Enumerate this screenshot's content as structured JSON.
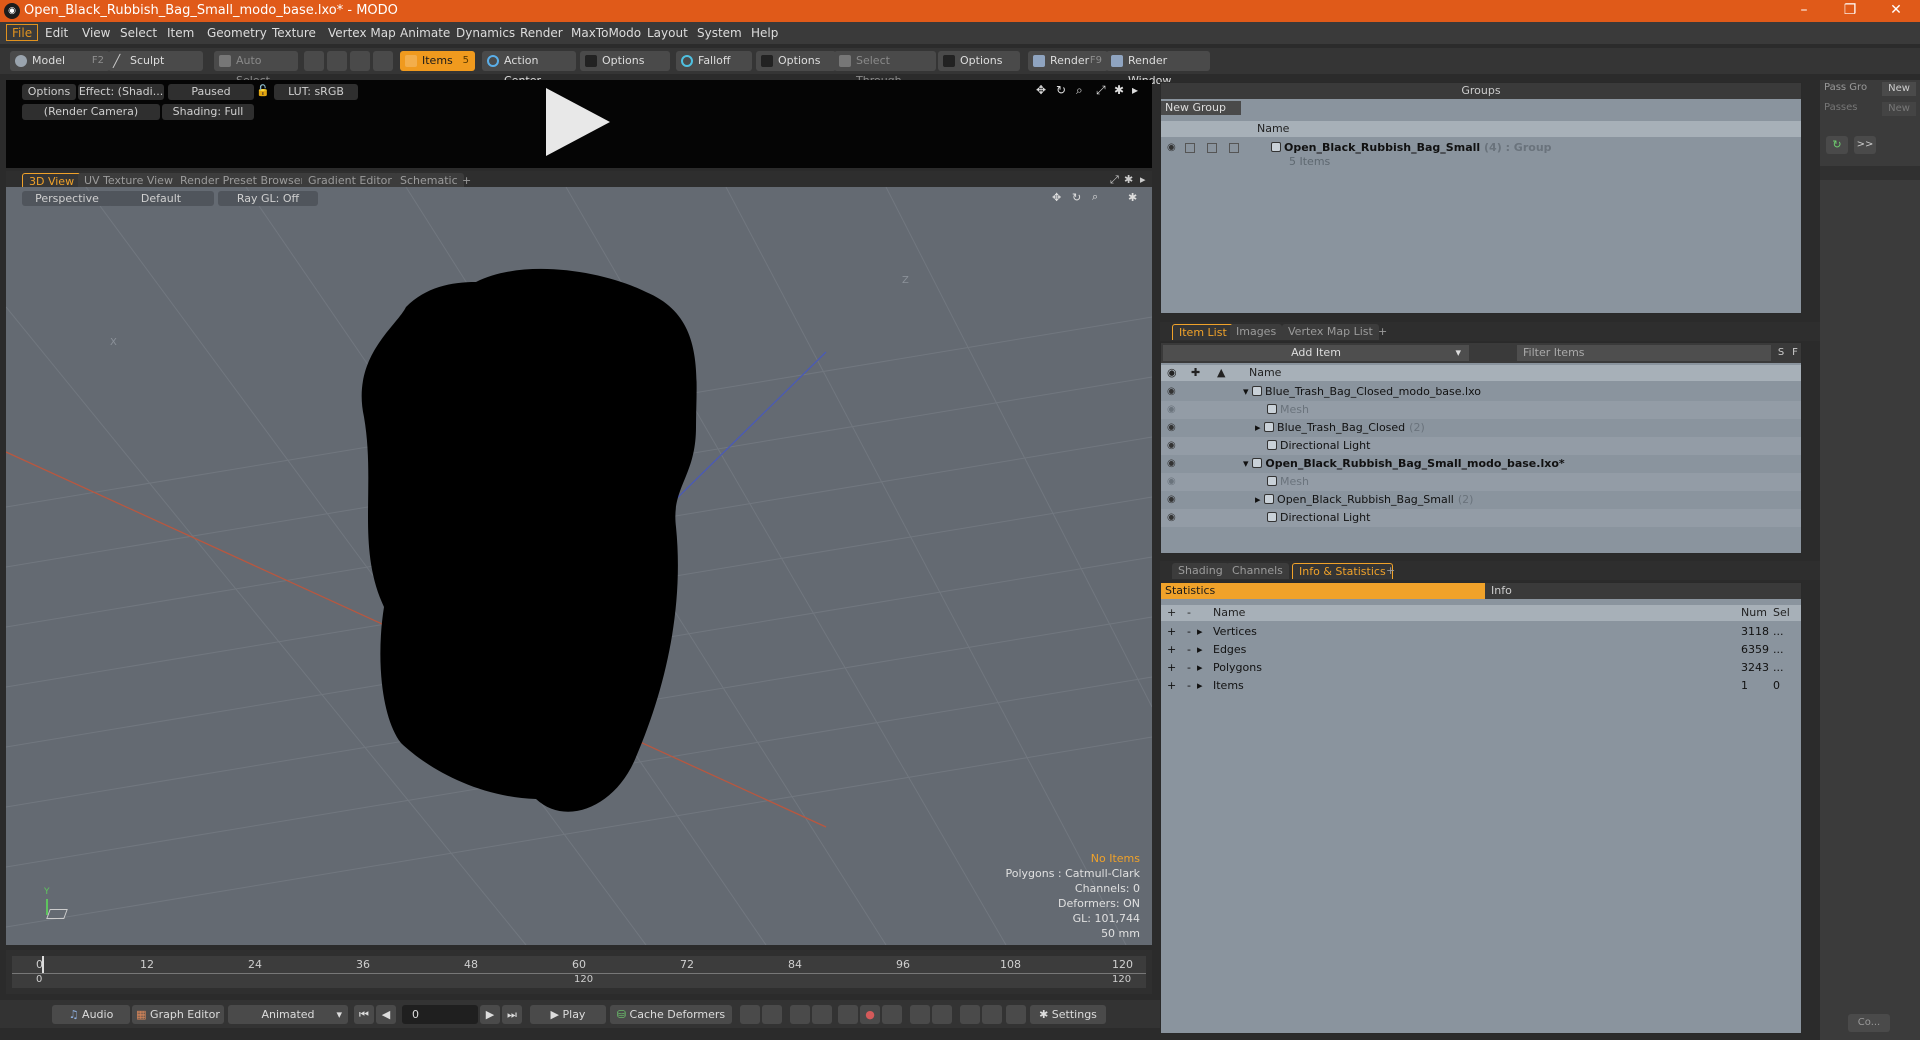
{
  "window": {
    "title": "Open_Black_Rubbish_Bag_Small_modo_base.lxo* - MODO",
    "logo": "modo-logo-icon",
    "minimize": "–",
    "restore": "❐",
    "close": "✕"
  },
  "menu": [
    "File",
    "Edit",
    "View",
    "Select",
    "Item",
    "Geometry",
    "Texture",
    "Vertex Map",
    "Animate",
    "Dynamics",
    "Render",
    "MaxToModo",
    "Layout",
    "System",
    "Help"
  ],
  "toolbar": {
    "model": "Model",
    "model_key": "F2",
    "sculpt": "Sculpt",
    "auto_select": "Auto Select",
    "items": "Items",
    "items_key": "5",
    "action_center": "Action Center",
    "options1": "Options",
    "falloff": "Falloff",
    "options2": "Options",
    "select_through": "Select Through",
    "options3": "Options",
    "render": "Render",
    "render_key": "F9",
    "render_window": "Render Window"
  },
  "preview": {
    "options": "Options",
    "effect": "Effect: (Shadi...",
    "paused": "Paused",
    "lut": "LUT: sRGB",
    "camera": "(Render Camera)",
    "shading": "Shading: Full"
  },
  "view_tabs": [
    "3D View",
    "UV Texture View",
    "Render Preset Browser",
    "Gradient Editor",
    "Schematic",
    "+"
  ],
  "viewport": {
    "perspective": "Perspective",
    "default": "Default",
    "raygl": "Ray GL: Off",
    "axis_x": "X",
    "axis_z": "Z",
    "axis_y": "Y"
  },
  "overlay": {
    "no_items": "No Items",
    "polygons": "Polygons : Catmull-Clark",
    "channels": "Channels: 0",
    "deformers": "Deformers: ON",
    "gl": "GL: 101,744",
    "focal": "50 mm"
  },
  "timeline": {
    "ticks": [
      "0",
      "12",
      "24",
      "36",
      "48",
      "60",
      "72",
      "84",
      "96",
      "108",
      "120"
    ],
    "start": "0",
    "mid": "120",
    "end": "120"
  },
  "bottombar": {
    "audio": "Audio",
    "graph_editor": "Graph Editor",
    "animated": "Animated",
    "frame": "0",
    "play": "Play",
    "cache": "Cache Deformers",
    "settings": "Settings"
  },
  "groups": {
    "title": "Groups",
    "new_group": "New Group",
    "col_name": "Name",
    "item_name": "Open_Black_Rubbish_Bag_Small",
    "item_count": "(4)",
    "item_type": ": Group",
    "item_sub": "5 Items"
  },
  "pass": {
    "pass_gro": "Pass Gro",
    "new1": "New",
    "passes": "Passes",
    "new2": "New",
    "arrow": ">>",
    "co": "Co..."
  },
  "itemlist_tabs": [
    "Item List",
    "Images",
    "Vertex Map List",
    "+"
  ],
  "itemlist": {
    "add_item": "Add Item",
    "filter": "Filter Items",
    "s": "S",
    "f": "F",
    "col_name": "Name",
    "rows": [
      {
        "label": "Blue_Trash_Bag_Closed_modo_base.lxo",
        "indent": 0,
        "bold": false,
        "dim": false
      },
      {
        "label": "Mesh",
        "indent": 2,
        "bold": false,
        "dim": true
      },
      {
        "label": "Blue_Trash_Bag_Closed",
        "count": "(2)",
        "indent": 1,
        "bold": false,
        "dim": false
      },
      {
        "label": "Directional Light",
        "indent": 2,
        "bold": false,
        "dim": false
      },
      {
        "label": "Open_Black_Rubbish_Bag_Small_modo_base.lxo*",
        "indent": 0,
        "bold": true,
        "dim": false
      },
      {
        "label": "Mesh",
        "indent": 2,
        "bold": false,
        "dim": true
      },
      {
        "label": "Open_Black_Rubbish_Bag_Small",
        "count": "(2)",
        "indent": 1,
        "bold": false,
        "dim": false
      },
      {
        "label": "Directional Light",
        "indent": 2,
        "bold": false,
        "dim": false
      }
    ]
  },
  "info_tabs": [
    "Shading",
    "Channels",
    "Info & Statistics",
    "+"
  ],
  "stats": {
    "tab_stats": "Statistics",
    "tab_info": "Info",
    "col_name": "Name",
    "col_num": "Num",
    "col_sel": "Sel",
    "rows": [
      {
        "name": "Vertices",
        "num": "3118",
        "sel": "..."
      },
      {
        "name": "Edges",
        "num": "6359",
        "sel": "..."
      },
      {
        "name": "Polygons",
        "num": "3243",
        "sel": "..."
      },
      {
        "name": "Items",
        "num": "1",
        "sel": "0"
      }
    ]
  },
  "colors": {
    "title": "#e05a19",
    "accent": "#f0a22a",
    "panel": "#8a949e",
    "viewport": "#646a72"
  }
}
